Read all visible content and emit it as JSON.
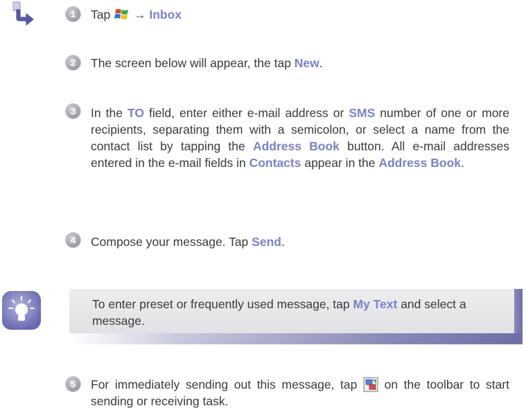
{
  "steps": [
    {
      "num": "1",
      "pre": "Tap ",
      "arrow": "→",
      "bold": "Inbox"
    },
    {
      "num": "2",
      "pre": "The screen below will appear, the tap ",
      "bold": "New",
      "post": "."
    },
    {
      "num": "3",
      "t1": "In the ",
      "b1": "TO",
      "t2": " field, enter either e-mail address or ",
      "b2": "SMS",
      "t3": " number of one or more recipients, separating them with a semicolon, or select a name from the contact list by tapping the ",
      "b3": "Address Book",
      "t4": " button. All e-mail addresses entered in the e-mail fields in ",
      "b4": "Contacts",
      "t5": " appear in the ",
      "b5": "Address Book",
      "t6": "."
    },
    {
      "num": "4",
      "pre": "Compose your message.  Tap ",
      "bold": "Send",
      "post": "."
    },
    {
      "num": "5",
      "pre": "For immediately sending out this message, tap ",
      "post": " on the toolbar to start sending or receiving task."
    }
  ],
  "tip": {
    "pre": "To enter preset or frequently used message, tap ",
    "bold": "My Text",
    "post": " and select a message."
  },
  "icons": [
    "arrow-pointer-icon",
    "windows-start-icon",
    "lightbulb-tip-icon",
    "send-receive-icon"
  ],
  "colors": {
    "highlight": "#7b82c4",
    "text": "#3a3a3a",
    "badge": "#9a9aa2"
  }
}
